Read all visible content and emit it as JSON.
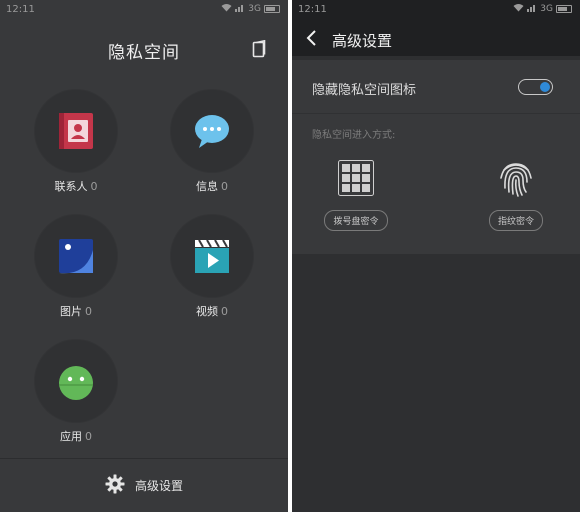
{
  "left_screen": {
    "status": {
      "time": "12:11",
      "network": "3G"
    },
    "title": "隐私空间",
    "apps": [
      {
        "name": "联系人",
        "count": "0",
        "icon": "contacts-icon"
      },
      {
        "name": "信息",
        "count": "0",
        "icon": "messages-icon"
      },
      {
        "name": "图片",
        "count": "0",
        "icon": "gallery-icon"
      },
      {
        "name": "视频",
        "count": "0",
        "icon": "video-icon"
      },
      {
        "name": "应用",
        "count": "0",
        "icon": "android-icon"
      }
    ],
    "bottom_label": "高级设置",
    "colors": {
      "contacts": "#c4364a",
      "messages": "#6dc2ec",
      "gallery": "#3a63c9",
      "video": "#2aa3b5",
      "android": "#62b858"
    }
  },
  "right_screen": {
    "status": {
      "time": "12:11",
      "network": "3G"
    },
    "title": "高级设置",
    "hide_icon_label": "隐藏隐私空间图标",
    "hide_icon_enabled": true,
    "entry_label": "隐私空间进入方式:",
    "methods": [
      {
        "label": "拨号盘密令",
        "icon": "dialpad-icon"
      },
      {
        "label": "指纹密令",
        "icon": "fingerprint-icon"
      }
    ],
    "accent": "#2f8ad8"
  }
}
